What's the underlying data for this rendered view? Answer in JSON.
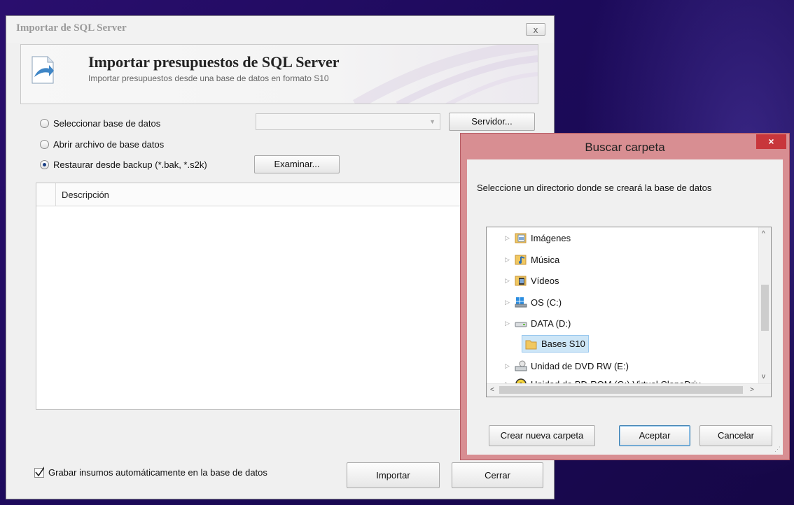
{
  "main_window": {
    "title": "Importar de SQL Server",
    "close": "x",
    "header": {
      "title": "Importar presupuestos de SQL Server",
      "subtitle": "Importar presupuestos desde una base de datos en formato S10"
    },
    "options": [
      {
        "label": "Seleccionar base de datos",
        "checked": false
      },
      {
        "label": "Abrir archivo de base datos",
        "checked": false
      },
      {
        "label": "Restaurar desde backup (*.bak, *.s2k)",
        "checked": true
      }
    ],
    "database_select": {
      "value": ""
    },
    "server_button": "Servidor...",
    "browse_button": "Examinar...",
    "table": {
      "columns": [
        "Descripción"
      ],
      "rows": []
    },
    "auto_save_checkbox": {
      "label": "Grabar insumos automáticamente en la base de datos",
      "checked": true
    },
    "import_button": "Importar",
    "close_button": "Cerrar"
  },
  "folder_dialog": {
    "title": "Buscar carpeta",
    "close": "×",
    "instruction": "Seleccione un directorio donde se creará la base de datos",
    "tree": [
      {
        "label": "Imágenes",
        "icon": "pictures-folder-icon"
      },
      {
        "label": "Música",
        "icon": "music-folder-icon"
      },
      {
        "label": "Vídeos",
        "icon": "videos-folder-icon"
      },
      {
        "label": "OS (C:)",
        "icon": "windows-drive-icon"
      },
      {
        "label": "DATA (D:)",
        "icon": "hard-drive-icon"
      },
      {
        "label": "Bases S10",
        "icon": "folder-icon",
        "selected": true
      },
      {
        "label": "Unidad de DVD RW (E:)",
        "icon": "dvd-drive-icon"
      },
      {
        "label": "Unidad de BD-ROM (G:) Virtual CloneDriv",
        "icon": "bdrom-drive-icon"
      }
    ],
    "new_folder_button": "Crear nueva carpeta",
    "accept_button": "Aceptar",
    "cancel_button": "Cancelar"
  }
}
